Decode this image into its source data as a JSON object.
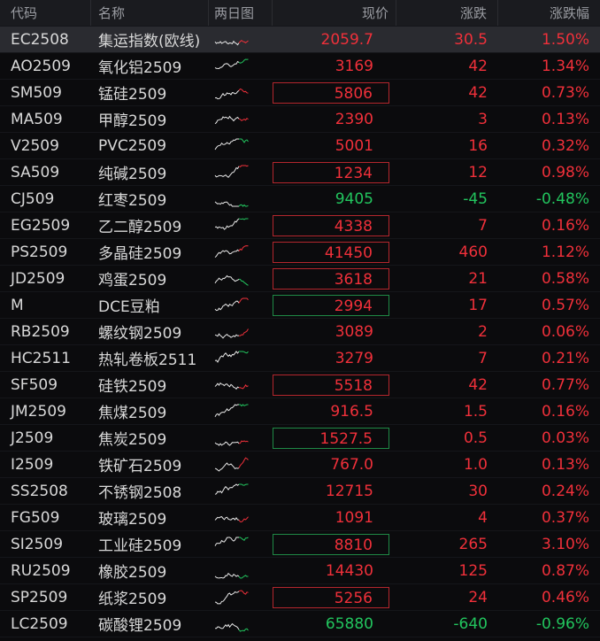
{
  "columns": {
    "code": "代码",
    "name": "名称",
    "chart": "两日图",
    "price": "现价",
    "change": "涨跌",
    "pct": "涨跌幅"
  },
  "colors": {
    "up": "#f0303a",
    "down": "#22c55e"
  },
  "rows": [
    {
      "code": "EC2508",
      "name": "集运指数(欧线)",
      "price": "2059.7",
      "change": "30.5",
      "pct": "1.50%",
      "dir": "up",
      "boxed": false,
      "selected": true
    },
    {
      "code": "AO2509",
      "name": "氧化铝2509",
      "price": "3169",
      "change": "42",
      "pct": "1.34%",
      "dir": "up",
      "boxed": false
    },
    {
      "code": "SM509",
      "name": "锰硅2509",
      "price": "5806",
      "change": "42",
      "pct": "0.73%",
      "dir": "up",
      "boxed": true
    },
    {
      "code": "MA509",
      "name": "甲醇2509",
      "price": "2390",
      "change": "3",
      "pct": "0.13%",
      "dir": "up",
      "boxed": false
    },
    {
      "code": "V2509",
      "name": "PVC2509",
      "price": "5001",
      "change": "16",
      "pct": "0.32%",
      "dir": "up",
      "boxed": false
    },
    {
      "code": "SA509",
      "name": "纯碱2509",
      "price": "1234",
      "change": "12",
      "pct": "0.98%",
      "dir": "up",
      "boxed": true
    },
    {
      "code": "CJ509",
      "name": "红枣2509",
      "price": "9405",
      "change": "-45",
      "pct": "-0.48%",
      "dir": "down",
      "boxed": false
    },
    {
      "code": "EG2509",
      "name": "乙二醇2509",
      "price": "4338",
      "change": "7",
      "pct": "0.16%",
      "dir": "up",
      "boxed": true
    },
    {
      "code": "PS2509",
      "name": "多晶硅2509",
      "price": "41450",
      "change": "460",
      "pct": "1.12%",
      "dir": "up",
      "boxed": true
    },
    {
      "code": "JD2509",
      "name": "鸡蛋2509",
      "price": "3618",
      "change": "21",
      "pct": "0.58%",
      "dir": "up",
      "boxed": true
    },
    {
      "code": "M",
      "name": "DCE豆粕",
      "price": "2994",
      "change": "17",
      "pct": "0.57%",
      "dir": "up",
      "boxed": true,
      "boxColor": "down"
    },
    {
      "code": "RB2509",
      "name": "螺纹钢2509",
      "price": "3089",
      "change": "2",
      "pct": "0.06%",
      "dir": "up",
      "boxed": false
    },
    {
      "code": "HC2511",
      "name": "热轧卷板2511",
      "price": "3279",
      "change": "7",
      "pct": "0.21%",
      "dir": "up",
      "boxed": false
    },
    {
      "code": "SF509",
      "name": "硅铁2509",
      "price": "5518",
      "change": "42",
      "pct": "0.77%",
      "dir": "up",
      "boxed": true
    },
    {
      "code": "JM2509",
      "name": "焦煤2509",
      "price": "916.5",
      "change": "1.5",
      "pct": "0.16%",
      "dir": "up",
      "boxed": false
    },
    {
      "code": "J2509",
      "name": "焦炭2509",
      "price": "1527.5",
      "change": "0.5",
      "pct": "0.03%",
      "dir": "up",
      "boxed": true,
      "boxColor": "down"
    },
    {
      "code": "I2509",
      "name": "铁矿石2509",
      "price": "767.0",
      "change": "1.0",
      "pct": "0.13%",
      "dir": "up",
      "boxed": false
    },
    {
      "code": "SS2508",
      "name": "不锈钢2508",
      "price": "12715",
      "change": "30",
      "pct": "0.24%",
      "dir": "up",
      "boxed": false
    },
    {
      "code": "FG509",
      "name": "玻璃2509",
      "price": "1091",
      "change": "4",
      "pct": "0.37%",
      "dir": "up",
      "boxed": false
    },
    {
      "code": "SI2509",
      "name": "工业硅2509",
      "price": "8810",
      "change": "265",
      "pct": "3.10%",
      "dir": "up",
      "boxed": true,
      "boxColor": "down"
    },
    {
      "code": "RU2509",
      "name": "橡胶2509",
      "price": "14430",
      "change": "125",
      "pct": "0.87%",
      "dir": "up",
      "boxed": false
    },
    {
      "code": "SP2509",
      "name": "纸浆2509",
      "price": "5256",
      "change": "24",
      "pct": "0.46%",
      "dir": "up",
      "boxed": true
    },
    {
      "code": "LC2509",
      "name": "碳酸锂2509",
      "price": "65880",
      "change": "-640",
      "pct": "-0.96%",
      "dir": "down",
      "boxed": false
    }
  ]
}
